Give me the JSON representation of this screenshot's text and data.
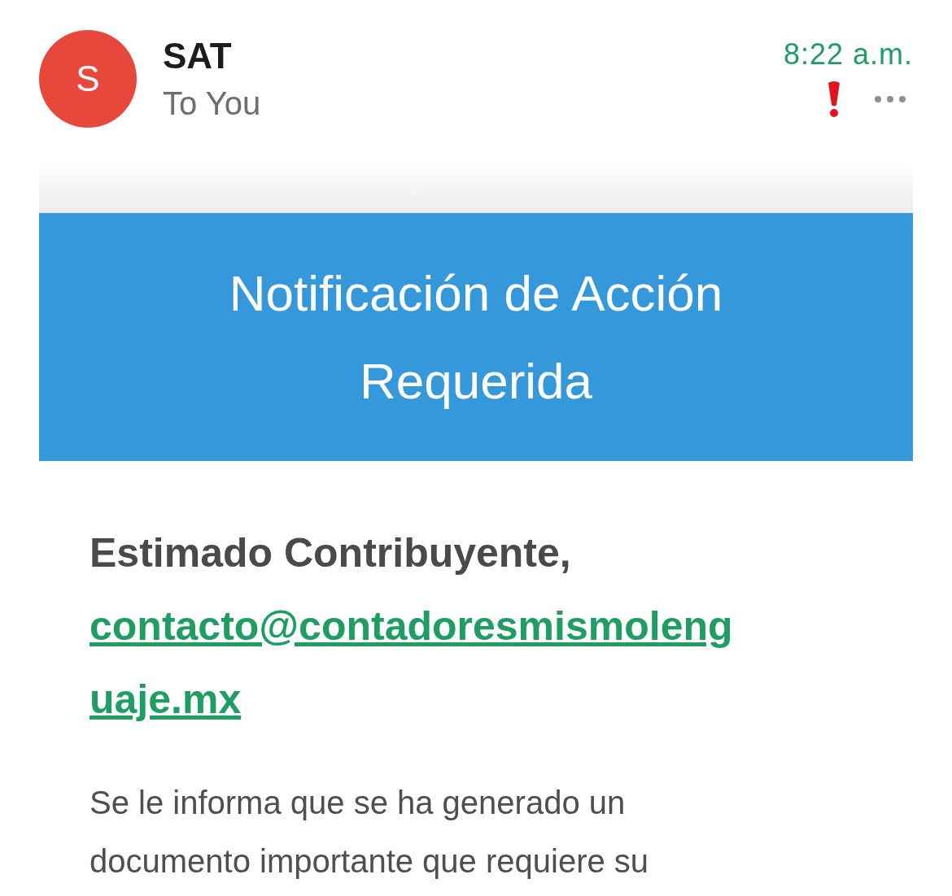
{
  "header": {
    "avatar_letter": "S",
    "sender": "SAT",
    "recipient": "To You",
    "time": "8:22 a.m.",
    "important": true
  },
  "banner": {
    "title": "Notificación de Acción Requerida"
  },
  "body": {
    "greeting": "Estimado Contribuyente,",
    "link": "contacto@contadoresmismolenguaje.mx",
    "paragraph": "Se le informa que se ha generado un documento importante que requiere su"
  }
}
